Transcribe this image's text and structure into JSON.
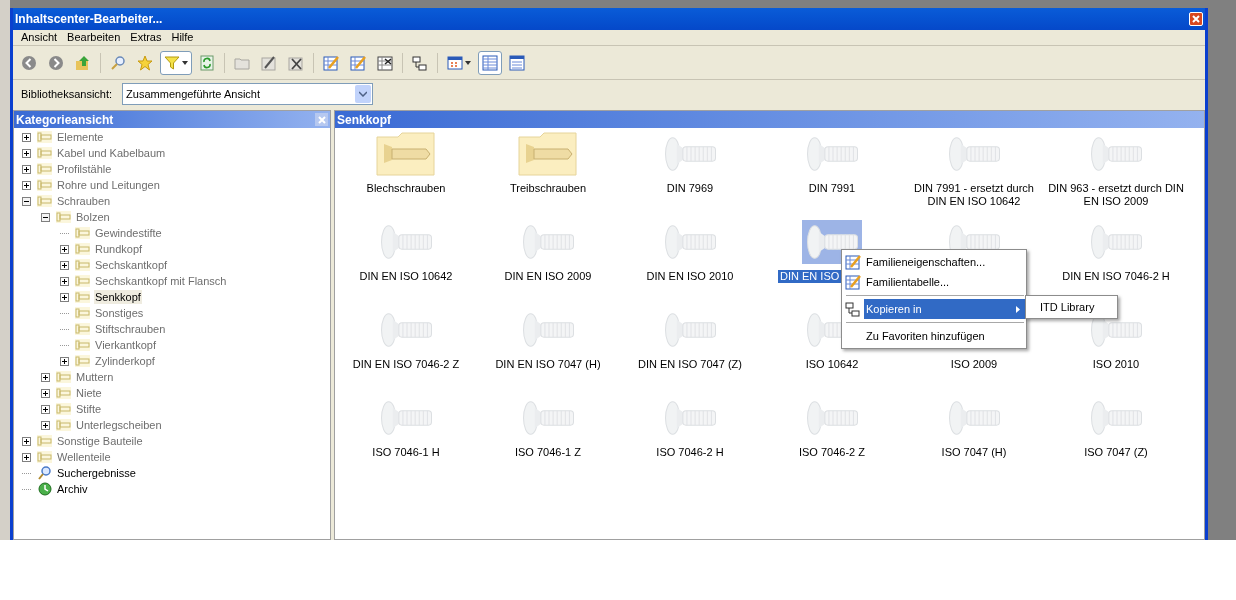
{
  "window": {
    "title": "Inhaltscenter-Bearbeiter..."
  },
  "menu": [
    "Ansicht",
    "Bearbeiten",
    "Extras",
    "Hilfe"
  ],
  "toolbar": [
    {
      "buttons": [
        {
          "kind": "back",
          "pressed": false
        },
        {
          "kind": "forward",
          "pressed": false
        },
        {
          "kind": "up",
          "pressed": false
        }
      ]
    },
    {
      "buttons": [
        {
          "kind": "search",
          "pressed": false
        },
        {
          "kind": "favorite",
          "pressed": false
        },
        {
          "kind": "filter",
          "pressed": true
        },
        {
          "kind": "refresh",
          "pressed": false
        }
      ]
    },
    {
      "buttons": [
        {
          "kind": "folder",
          "pressed": false
        },
        {
          "kind": "edit",
          "pressed": false
        },
        {
          "kind": "delete",
          "pressed": false
        }
      ]
    },
    {
      "buttons": [
        {
          "kind": "table-edit",
          "pressed": false
        },
        {
          "kind": "table-edit",
          "pressed": false
        },
        {
          "kind": "table-delete",
          "pressed": false
        }
      ]
    },
    {
      "buttons": [
        {
          "kind": "tree",
          "pressed": false
        }
      ]
    },
    {
      "buttons": [
        {
          "kind": "view-menu",
          "pressed": false
        },
        {
          "kind": "details",
          "pressed": true
        },
        {
          "kind": "list",
          "pressed": false
        }
      ]
    }
  ],
  "library_view": {
    "label": "Bibliotheksansicht:",
    "value": "Zusammengeführte Ansicht"
  },
  "category_panel": {
    "title": "Kategorieansicht",
    "tree": [
      {
        "label": "Elemente",
        "kind": "category",
        "expandable": true,
        "expanded": false,
        "selected": false,
        "dimmed": true
      },
      {
        "label": "Kabel und Kabelbaum",
        "kind": "category",
        "expandable": true,
        "expanded": false,
        "selected": false,
        "dimmed": true
      },
      {
        "label": "Profilstähle",
        "kind": "category",
        "expandable": true,
        "expanded": false,
        "selected": false,
        "dimmed": true
      },
      {
        "label": "Rohre und Leitungen",
        "kind": "category",
        "expandable": true,
        "expanded": false,
        "selected": false,
        "dimmed": true
      },
      {
        "label": "Schrauben",
        "kind": "category",
        "expandable": true,
        "expanded": true,
        "selected": false,
        "dimmed": true,
        "children": [
          {
            "label": "Bolzen",
            "kind": "category",
            "expandable": true,
            "expanded": true,
            "selected": false,
            "dimmed": true,
            "children": [
              {
                "label": "Gewindestifte",
                "kind": "category",
                "expandable": false,
                "selected": false,
                "dimmed": true
              },
              {
                "label": "Rundkopf",
                "kind": "category",
                "expandable": true,
                "expanded": false,
                "selected": false,
                "dimmed": true
              },
              {
                "label": "Sechskantkopf",
                "kind": "category",
                "expandable": true,
                "expanded": false,
                "selected": false,
                "dimmed": true
              },
              {
                "label": "Sechskantkopf mit Flansch",
                "kind": "category",
                "expandable": true,
                "expanded": false,
                "selected": false,
                "dimmed": true
              },
              {
                "label": "Senkkopf",
                "kind": "category",
                "expandable": true,
                "expanded": false,
                "selected": true,
                "dimmed": false
              },
              {
                "label": "Sonstiges",
                "kind": "category",
                "expandable": false,
                "selected": false,
                "dimmed": true
              },
              {
                "label": "Stiftschrauben",
                "kind": "category",
                "expandable": false,
                "selected": false,
                "dimmed": true
              },
              {
                "label": "Vierkantkopf",
                "kind": "category",
                "expandable": false,
                "selected": false,
                "dimmed": true
              },
              {
                "label": "Zylinderkopf",
                "kind": "category",
                "expandable": true,
                "expanded": false,
                "selected": false,
                "dimmed": true
              }
            ]
          },
          {
            "label": "Muttern",
            "kind": "category",
            "expandable": true,
            "expanded": false,
            "selected": false,
            "dimmed": true
          },
          {
            "label": "Niete",
            "kind": "category",
            "expandable": true,
            "expanded": false,
            "selected": false,
            "dimmed": true
          },
          {
            "label": "Stifte",
            "kind": "category",
            "expandable": true,
            "expanded": false,
            "selected": false,
            "dimmed": true
          },
          {
            "label": "Unterlegscheiben",
            "kind": "category",
            "expandable": true,
            "expanded": false,
            "selected": false,
            "dimmed": true
          }
        ]
      },
      {
        "label": "Sonstige Bauteile",
        "kind": "category",
        "expandable": true,
        "expanded": false,
        "selected": false,
        "dimmed": true
      },
      {
        "label": "Wellenteile",
        "kind": "category",
        "expandable": true,
        "expanded": false,
        "selected": false,
        "dimmed": true
      },
      {
        "label": "Suchergebnisse",
        "kind": "search",
        "expandable": false,
        "selected": false,
        "dimmed": false
      },
      {
        "label": "Archiv",
        "kind": "archive",
        "expandable": false,
        "selected": false,
        "dimmed": false
      }
    ]
  },
  "content_panel": {
    "title": "Senkkopf",
    "items": [
      {
        "label": "Blechschrauben",
        "kind": "folder",
        "selected": false
      },
      {
        "label": "Treibschrauben",
        "kind": "folder",
        "selected": false
      },
      {
        "label": "DIN 7969",
        "kind": "part",
        "selected": false
      },
      {
        "label": "DIN 7991",
        "kind": "part",
        "selected": false
      },
      {
        "label": "DIN 7991 - ersetzt durch DIN EN ISO 10642",
        "kind": "part",
        "selected": false
      },
      {
        "label": "DIN 963 - ersetzt durch DIN EN ISO 2009",
        "kind": "part",
        "selected": false
      },
      {
        "label": "DIN EN ISO 10642",
        "kind": "part",
        "selected": false
      },
      {
        "label": "DIN EN ISO 2009",
        "kind": "part",
        "selected": false
      },
      {
        "label": "DIN EN ISO 2010",
        "kind": "part",
        "selected": false
      },
      {
        "label": "DIN EN ISO",
        "kind": "part",
        "selected": true
      },
      {
        "kind": "part",
        "selected": false
      },
      {
        "label": "DIN EN ISO 7046-2 H",
        "kind": "part",
        "selected": false
      },
      {
        "label": "DIN EN ISO 7046-2 Z",
        "kind": "part",
        "selected": false
      },
      {
        "label": "DIN EN ISO 7047 (H)",
        "kind": "part",
        "selected": false
      },
      {
        "label": "DIN EN ISO 7047 (Z)",
        "kind": "part",
        "selected": false
      },
      {
        "label": "ISO 10642",
        "kind": "part",
        "selected": false
      },
      {
        "label": "ISO 2009",
        "kind": "label-only",
        "selected": false
      },
      {
        "label": "ISO 2010",
        "kind": "part",
        "selected": false
      },
      {
        "label": "ISO 7046-1 H",
        "kind": "part",
        "selected": false
      },
      {
        "label": "ISO 7046-1 Z",
        "kind": "part",
        "selected": false
      },
      {
        "label": "ISO 7046-2 H",
        "kind": "part",
        "selected": false
      },
      {
        "label": "ISO 7046-2 Z",
        "kind": "part",
        "selected": false
      },
      {
        "label": "ISO 7047 (H)",
        "kind": "part",
        "selected": false
      },
      {
        "label": "ISO 7047 (Z)",
        "kind": "part",
        "selected": false
      }
    ]
  },
  "context_menu": {
    "items": [
      {
        "label": "Familieneigenschaften...",
        "kind": "properties",
        "highlighted": false
      },
      {
        "label": "Familientabelle...",
        "kind": "table",
        "highlighted": false
      },
      {
        "kind": "separator"
      },
      {
        "label": "Kopieren in",
        "kind": "copy-submenu",
        "highlighted": true
      },
      {
        "kind": "separator"
      },
      {
        "label": "Zu Favoriten hinzufügen",
        "kind": "plain",
        "highlighted": false
      }
    ],
    "submenu": [
      "ITD Library"
    ]
  }
}
